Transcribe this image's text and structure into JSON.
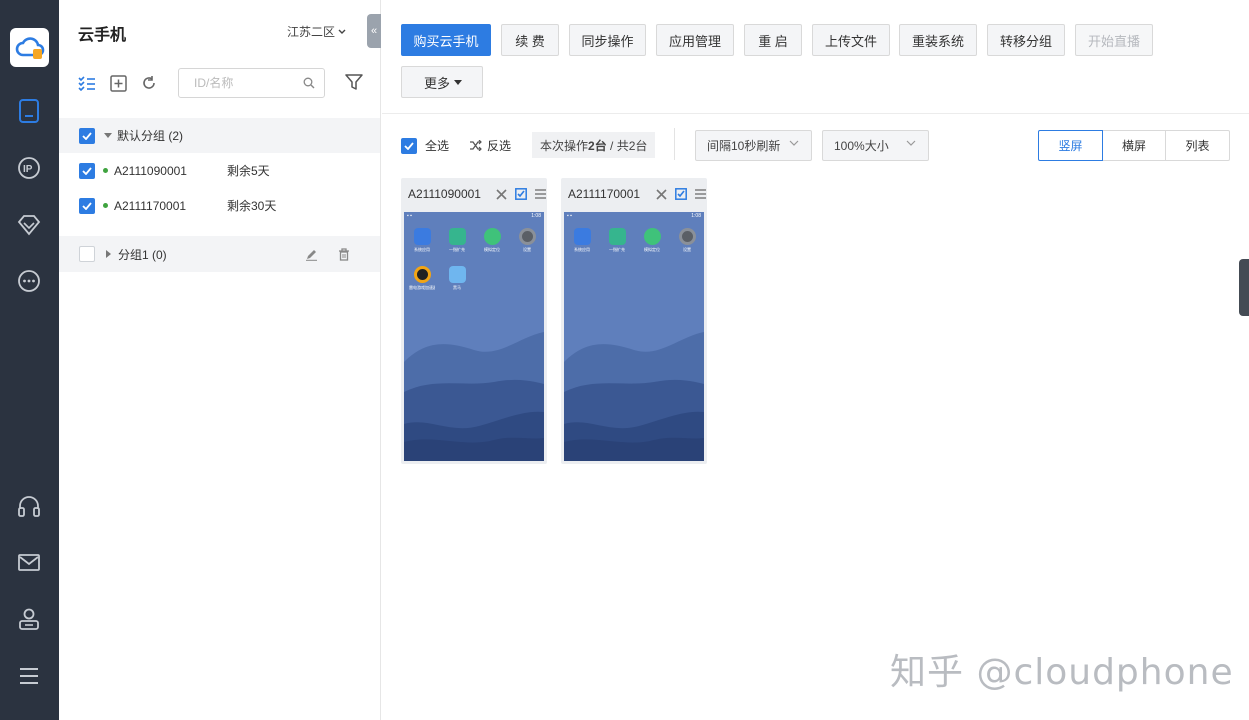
{
  "nav": {
    "items": [
      "phone-icon",
      "ip-icon",
      "vip-diamond-icon",
      "more-circle-icon",
      "headset-icon",
      "mail-icon",
      "user-icon",
      "menu-icon"
    ]
  },
  "sidebar": {
    "title": "云手机",
    "region": "江苏二区",
    "search_placeholder": "ID/名称",
    "groups": [
      {
        "name": "默认分组 (2)",
        "checked": true,
        "expanded": true,
        "devices": [
          {
            "id": "A2111090001",
            "remaining": "剩余5天",
            "checked": true
          },
          {
            "id": "A2111170001",
            "remaining": "剩余30天",
            "checked": true
          }
        ]
      },
      {
        "name": "分组1 (0)",
        "checked": false,
        "expanded": false,
        "devices": []
      }
    ]
  },
  "toolbar": {
    "buy": "购买云手机",
    "renew": "续 费",
    "sync": "同步操作",
    "apps": "应用管理",
    "reboot": "重 启",
    "upload": "上传文件",
    "reinstall": "重装系统",
    "move_group": "转移分组",
    "live": "开始直播",
    "more": "更多"
  },
  "controls": {
    "select_all": "全选",
    "invert": "反选",
    "op_prefix": "本次操作 ",
    "op_count": "2台",
    "op_suffix": " / 共2台",
    "refresh": "间隔10秒刷新",
    "size": "100%大小",
    "view_portrait": "竖屏",
    "view_landscape": "横屏",
    "view_list": "列表",
    "active_view": "竖屏"
  },
  "devices": [
    {
      "id": "A2111090001",
      "status_time": "1:08",
      "apps": [
        "系统应用",
        "一指扩充",
        "模拟定位",
        "设置",
        "雷电游戏加速器",
        "黑马"
      ]
    },
    {
      "id": "A2111170001",
      "status_time": "1:08",
      "apps": [
        "系统应用",
        "一指扩充",
        "模拟定位",
        "设置"
      ]
    }
  ],
  "watermark": "知乎 @cloudphone",
  "colors": {
    "accent": "#2d7ce2",
    "rail": "#2b3340",
    "online": "#3fa33f"
  }
}
